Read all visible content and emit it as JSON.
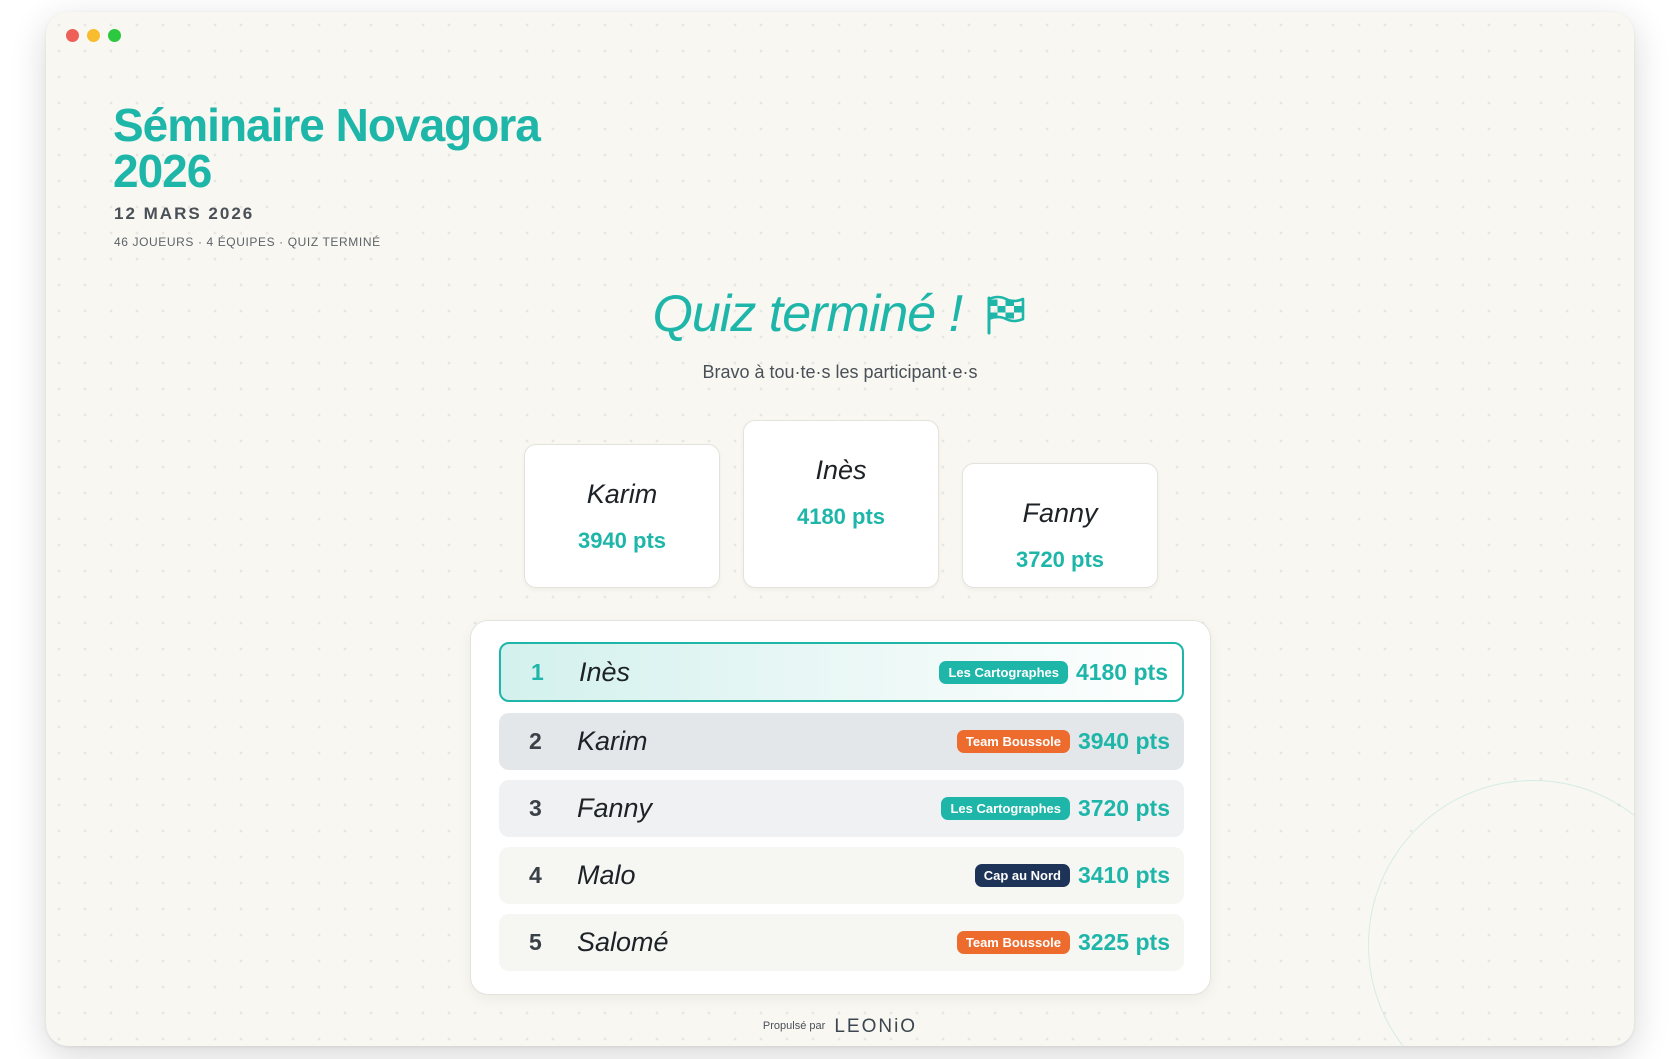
{
  "window": {
    "traffic_lights": [
      "#ee5f57",
      "#f8bd2e",
      "#2bc840"
    ]
  },
  "event": {
    "title": "Séminaire Novagora 2026",
    "date": "12 MARS 2026",
    "meta": "46 JOUEURS · 4 ÉQUIPES · QUIZ TERMINÉ"
  },
  "headline": {
    "text": "Quiz terminé !",
    "icon": "checkered-flag-icon"
  },
  "subtitle": "Bravo à tou·te·s les participant·e·s",
  "podium": {
    "first": {
      "name": "Inès",
      "points": "4180 pts"
    },
    "second": {
      "name": "Karim",
      "points": "3940 pts"
    },
    "third": {
      "name": "Fanny",
      "points": "3720 pts"
    }
  },
  "leaderboard": [
    {
      "rank": "1",
      "name": "Inès",
      "team": "Les Cartographes",
      "team_color": "#1fb6aa",
      "points": "4180 pts"
    },
    {
      "rank": "2",
      "name": "Karim",
      "team": "Team Boussole",
      "team_color": "#ec6b2d",
      "points": "3940 pts"
    },
    {
      "rank": "3",
      "name": "Fanny",
      "team": "Les Cartographes",
      "team_color": "#1fb6aa",
      "points": "3720 pts"
    },
    {
      "rank": "4",
      "name": "Malo",
      "team": "Cap au Nord",
      "team_color": "#1e3358",
      "points": "3410 pts"
    },
    {
      "rank": "5",
      "name": "Salomé",
      "team": "Team Boussole",
      "team_color": "#ec6b2d",
      "points": "3225 pts"
    }
  ],
  "footer": {
    "powered_by": "Propulsé par",
    "brand": "LEONiO"
  },
  "colors": {
    "accent": "#1fb6aa",
    "background": "#f8f7f1"
  }
}
